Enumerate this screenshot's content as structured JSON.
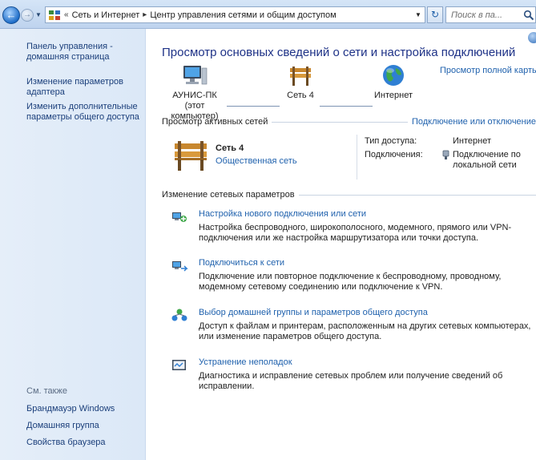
{
  "address_bar": {
    "crumb_root": "Сеть и Интернет",
    "crumb_current": "Центр управления сетями и общим доступом",
    "overflow_glyph": "«",
    "separator": "▸",
    "search_placeholder": "Поиск в па..."
  },
  "sidebar": {
    "links": [
      {
        "label": "Панель управления -\nдомашняя страница"
      },
      {
        "label": "Изменение параметров\nадаптера"
      },
      {
        "label": "Изменить дополнительные\nпараметры общего доступа"
      }
    ],
    "see_also_header": "См. также",
    "see_also_links": [
      {
        "label": "Брандмауэр Windows"
      },
      {
        "label": "Домашняя группа"
      },
      {
        "label": "Свойства браузера"
      }
    ]
  },
  "main": {
    "title": "Просмотр основных сведений о сети и настройка подключений",
    "full_map_link": "Просмотр полной карты",
    "map": {
      "computer_label": "АУНИС-ПК",
      "computer_sublabel": "(этот компьютер)",
      "network_label": "Сеть 4",
      "internet_label": "Интернет"
    },
    "active_networks": {
      "header": "Просмотр активных сетей",
      "connect_link": "Подключение или отключение",
      "network_name": "Сеть  4",
      "network_type": "Общественная сеть",
      "access_type_label": "Тип доступа:",
      "access_type_value": "Интернет",
      "connections_label": "Подключения:",
      "connection_value": "Подключение по\nлокальной сети"
    },
    "change_settings": {
      "header": "Изменение сетевых параметров",
      "tasks": [
        {
          "title": "Настройка нового подключения или сети",
          "desc": "Настройка беспроводного, широкополосного, модемного, прямого или VPN-подключения или же настройка маршрутизатора или точки доступа.",
          "icon": "network-setup-icon"
        },
        {
          "title": "Подключиться к сети",
          "desc": "Подключение или повторное подключение к беспроводному, проводному, модемному сетевому соединению или подключение к VPN.",
          "icon": "network-connect-icon"
        },
        {
          "title": "Выбор домашней группы и параметров общего доступа",
          "desc": "Доступ к файлам и принтерам, расположенным на других сетевых компьютерах, или изменение параметров общего доступа.",
          "icon": "homegroup-icon"
        },
        {
          "title": "Устранение неполадок",
          "desc": "Диагностика и исправление сетевых проблем или получение сведений об исправлении.",
          "icon": "troubleshoot-icon"
        }
      ]
    }
  },
  "colors": {
    "title_blue": "#1e3287",
    "link_blue": "#1f61ad",
    "sidebar_link": "#1a3e7a",
    "sidebar_bg": "#e5eef9"
  }
}
